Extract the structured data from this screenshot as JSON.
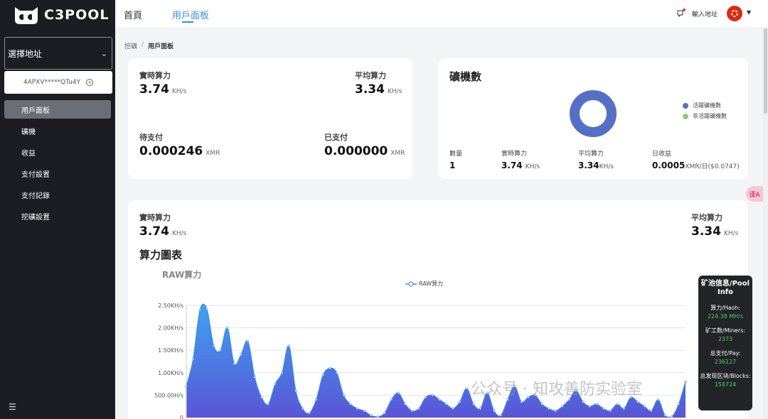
{
  "brand": {
    "name": "C3POOL"
  },
  "sidebar": {
    "address_select_label": "選擇地址",
    "address_chip": "4APXV*****QTu4Y",
    "items": [
      {
        "label": "用戶面板",
        "active": true
      },
      {
        "label": "礦機"
      },
      {
        "label": "收益"
      },
      {
        "label": "支付設置"
      },
      {
        "label": "支付記錄"
      },
      {
        "label": "挖礦設置"
      }
    ]
  },
  "header": {
    "tabs": [
      {
        "label": "首頁"
      },
      {
        "label": "用戶面板",
        "active": true
      }
    ],
    "input_address": "輸入地址",
    "language_flag": "hong-kong-flag-icon"
  },
  "breadcrumb": {
    "root": "挖礦",
    "separator": "/",
    "current": "用戶面板"
  },
  "summary": {
    "realtime_hash": {
      "label": "實時算力",
      "value": "3.74",
      "unit": "KH/s"
    },
    "avg_hash": {
      "label": "平均算力",
      "value": "3.34",
      "unit": "KH/s"
    },
    "pending": {
      "label": "待支付",
      "value": "0.000246",
      "unit": "XMR"
    },
    "paid": {
      "label": "已支付",
      "value": "0.000000",
      "unit": "XMR"
    }
  },
  "miners": {
    "title": "礦機數",
    "legend_active": "活躍礦機數",
    "legend_inactive": "非活躍礦機數",
    "active_ratio": 1,
    "colors": {
      "active": "#5470c6",
      "inactive": "#91cc75"
    },
    "count": {
      "label": "數量",
      "value": "1"
    },
    "realtime_hash": {
      "label": "實時算力",
      "value": "3.74",
      "unit": "KH/s"
    },
    "avg_hash": {
      "label": "平均算力",
      "value": "3.34",
      "unit": "KH/s"
    },
    "daily_income": {
      "label": "日收益",
      "value": "0.0005",
      "unit": "XMR/日($0.0747)"
    }
  },
  "hash_panel": {
    "realtime_hash": {
      "label": "實時算力",
      "value": "3.74",
      "unit": "KH/s"
    },
    "avg_hash": {
      "label": "平均算力",
      "value": "3.34",
      "unit": "KH/s"
    },
    "section_title": "算力圖表",
    "chart_title": "RAW算力"
  },
  "chart_data": {
    "type": "area",
    "title": "RAW算力",
    "series": [
      {
        "name": "RAW算力",
        "color": "#4a90e2",
        "values": [
          0.7,
          1.3,
          2.4,
          2.42,
          1.6,
          1.5,
          2.0,
          1.2,
          1.4,
          1.7,
          0.9,
          0.45,
          0.3,
          0.75,
          1.0,
          1.6,
          0.6,
          0.2,
          0.1,
          0.4,
          0.95,
          1.1,
          1.0,
          0.5,
          0.3,
          0.2,
          0.15,
          0.05,
          0.02,
          0.1,
          0.4,
          0.55,
          0.3,
          0.15,
          0.2,
          0.45,
          0.5,
          0.4,
          0.3,
          0.2,
          0.35,
          0.65,
          0.3,
          0.2,
          0.55,
          0.15,
          0.05,
          0.4,
          0.7,
          0.35,
          0.45,
          0.5,
          0.3,
          0.2,
          0.15,
          0.25,
          0.4,
          0.6,
          0.35,
          0.25,
          0.3,
          0.2,
          0.15,
          0.3,
          0.2,
          0.45,
          0.35,
          0.25,
          0.15,
          0.4,
          0.05,
          0.02,
          0.3,
          0.8
        ]
      }
    ],
    "yticks": [
      "0",
      "500.00H/s",
      "1.00KH/s",
      "1.50KH/s",
      "2.00KH/s",
      "2.50KH/s"
    ],
    "ylim": [
      0,
      2.5
    ],
    "grid": true,
    "legend": "top-center"
  },
  "pool_info": {
    "title": "矿池信息/Pool Info",
    "hash_label": "算力/Hash:",
    "hash_value": "224.38 MH/s",
    "miners_label": "矿工数/Miners:",
    "miners_value": "2373",
    "pay_label": "总支付/Pay:",
    "pay_value": "236127",
    "blocks_label": "总发现区块/Blocks:",
    "blocks_value": "158724"
  },
  "float_button": "译A",
  "watermark": "公众号 · 知攻善防实验室"
}
